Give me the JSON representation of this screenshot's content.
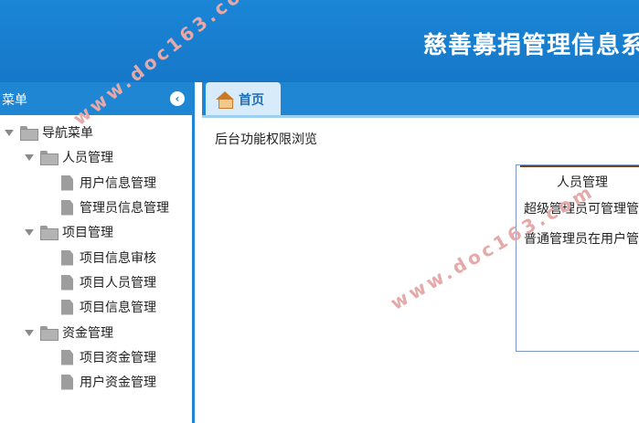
{
  "header": {
    "title": "慈善募捐管理信息系"
  },
  "sidebar": {
    "title": "菜单",
    "collapse_glyph": "‹",
    "tree": [
      {
        "label": "导航菜单"
      },
      {
        "label": "人员管理"
      },
      {
        "label": "用户信息管理"
      },
      {
        "label": "管理员信息管理"
      },
      {
        "label": "项目管理"
      },
      {
        "label": "项目信息审核"
      },
      {
        "label": "项目人员管理"
      },
      {
        "label": "项目信息管理"
      },
      {
        "label": "资金管理"
      },
      {
        "label": "项目资金管理"
      },
      {
        "label": "用户资金管理"
      }
    ]
  },
  "tabs": [
    {
      "label": "首页"
    }
  ],
  "content": {
    "title": "后台功能权限浏览",
    "card": {
      "title": "人员管理",
      "lines": [
        "超级管理员可管理管理",
        "普通管理员在用户管理"
      ]
    }
  },
  "watermark": {
    "text": "www.doc163.com"
  },
  "colors": {
    "header": "#1677c8",
    "panel": "#1f86d3",
    "tab_bg": "#d7ebfb"
  }
}
